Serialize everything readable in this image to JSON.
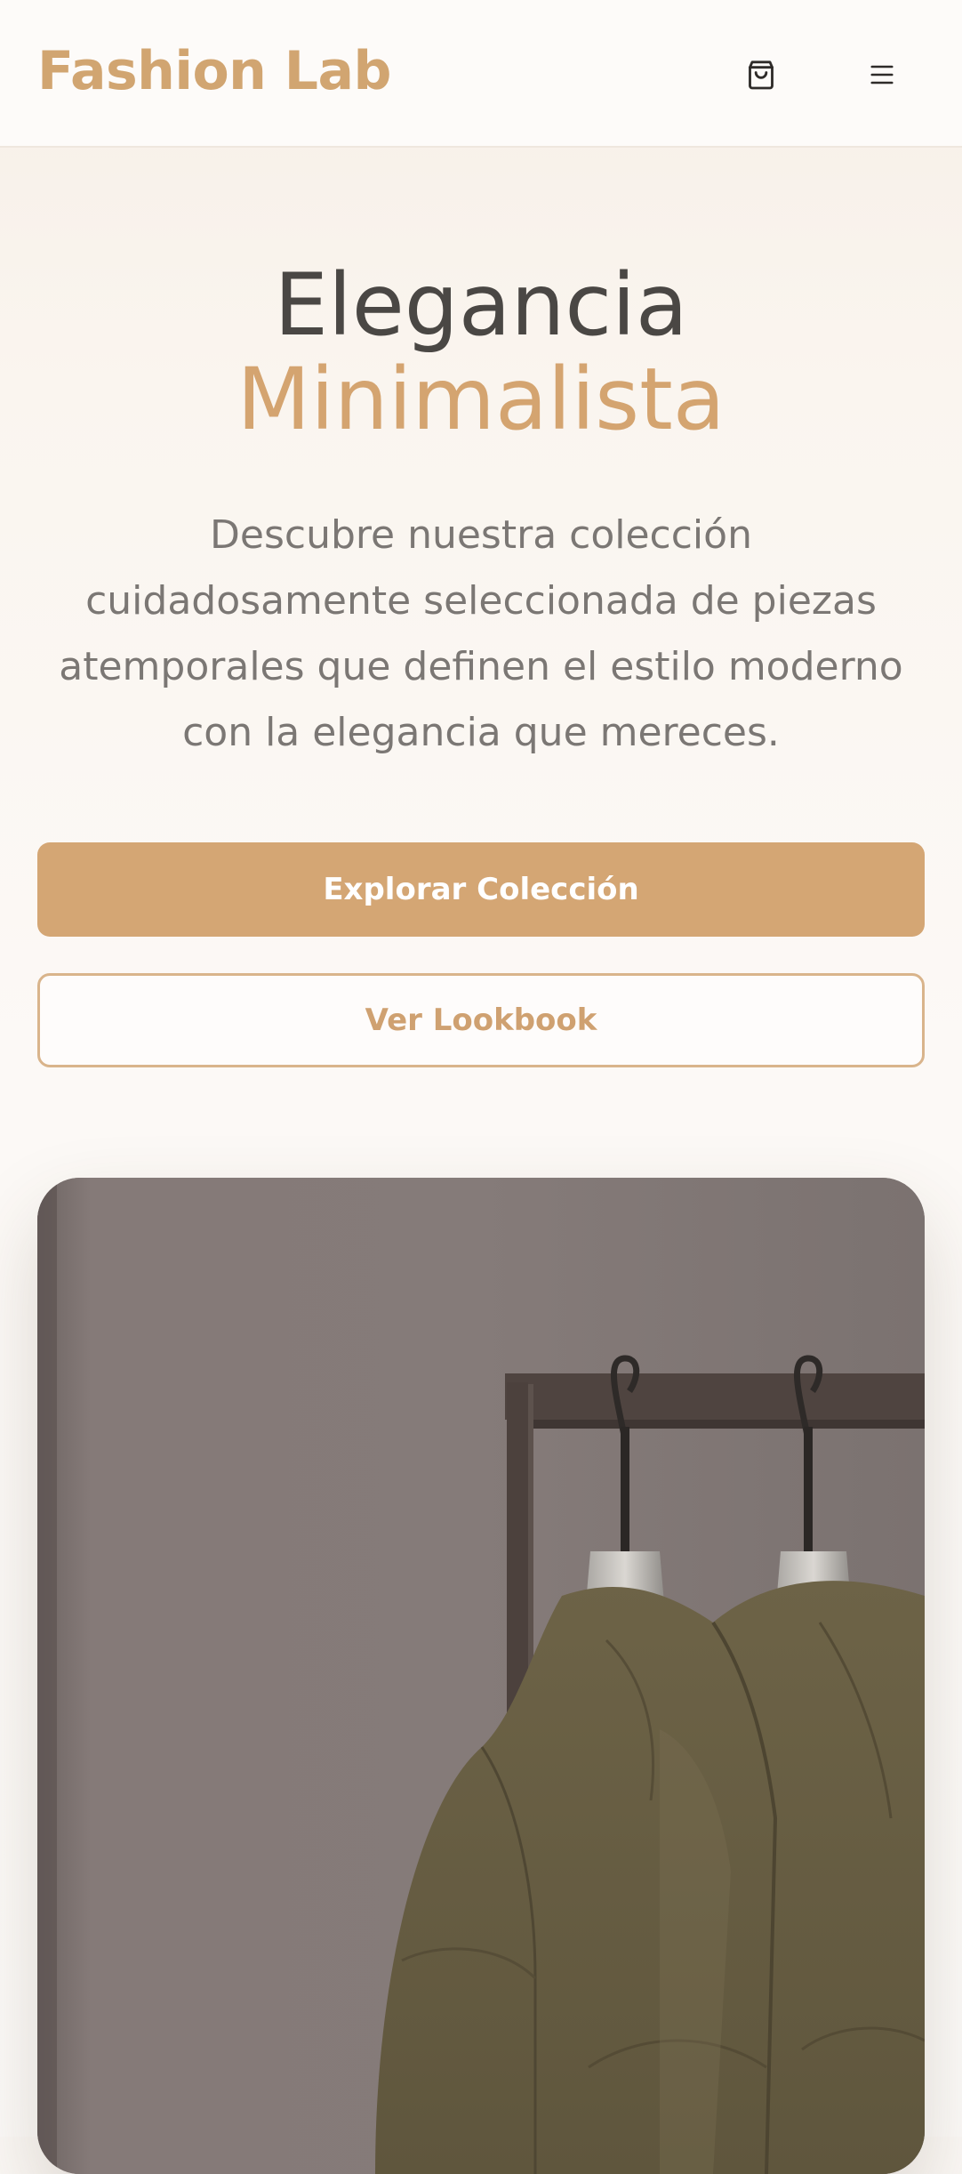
{
  "header": {
    "brand": "Fashion Lab",
    "cart_icon": "shopping-bag-icon",
    "menu_icon": "hamburger-menu-icon"
  },
  "hero": {
    "title_line1": "Elegancia",
    "title_line2": "Minimalista",
    "description": "Descubre nuestra colección cuidadosamente seleccionada de piezas atemporales que definen el estilo moderno con la elegancia que mereces.",
    "primary_button": "Explorar Colección",
    "secondary_button": "Ver Lookbook"
  },
  "hero_image": {
    "subject": "jackets-on-clothing-rack"
  },
  "colors": {
    "accent": "#d4a674",
    "heading": "#4a4744",
    "body_text": "#7b7774",
    "background": "#fbf8f5"
  }
}
